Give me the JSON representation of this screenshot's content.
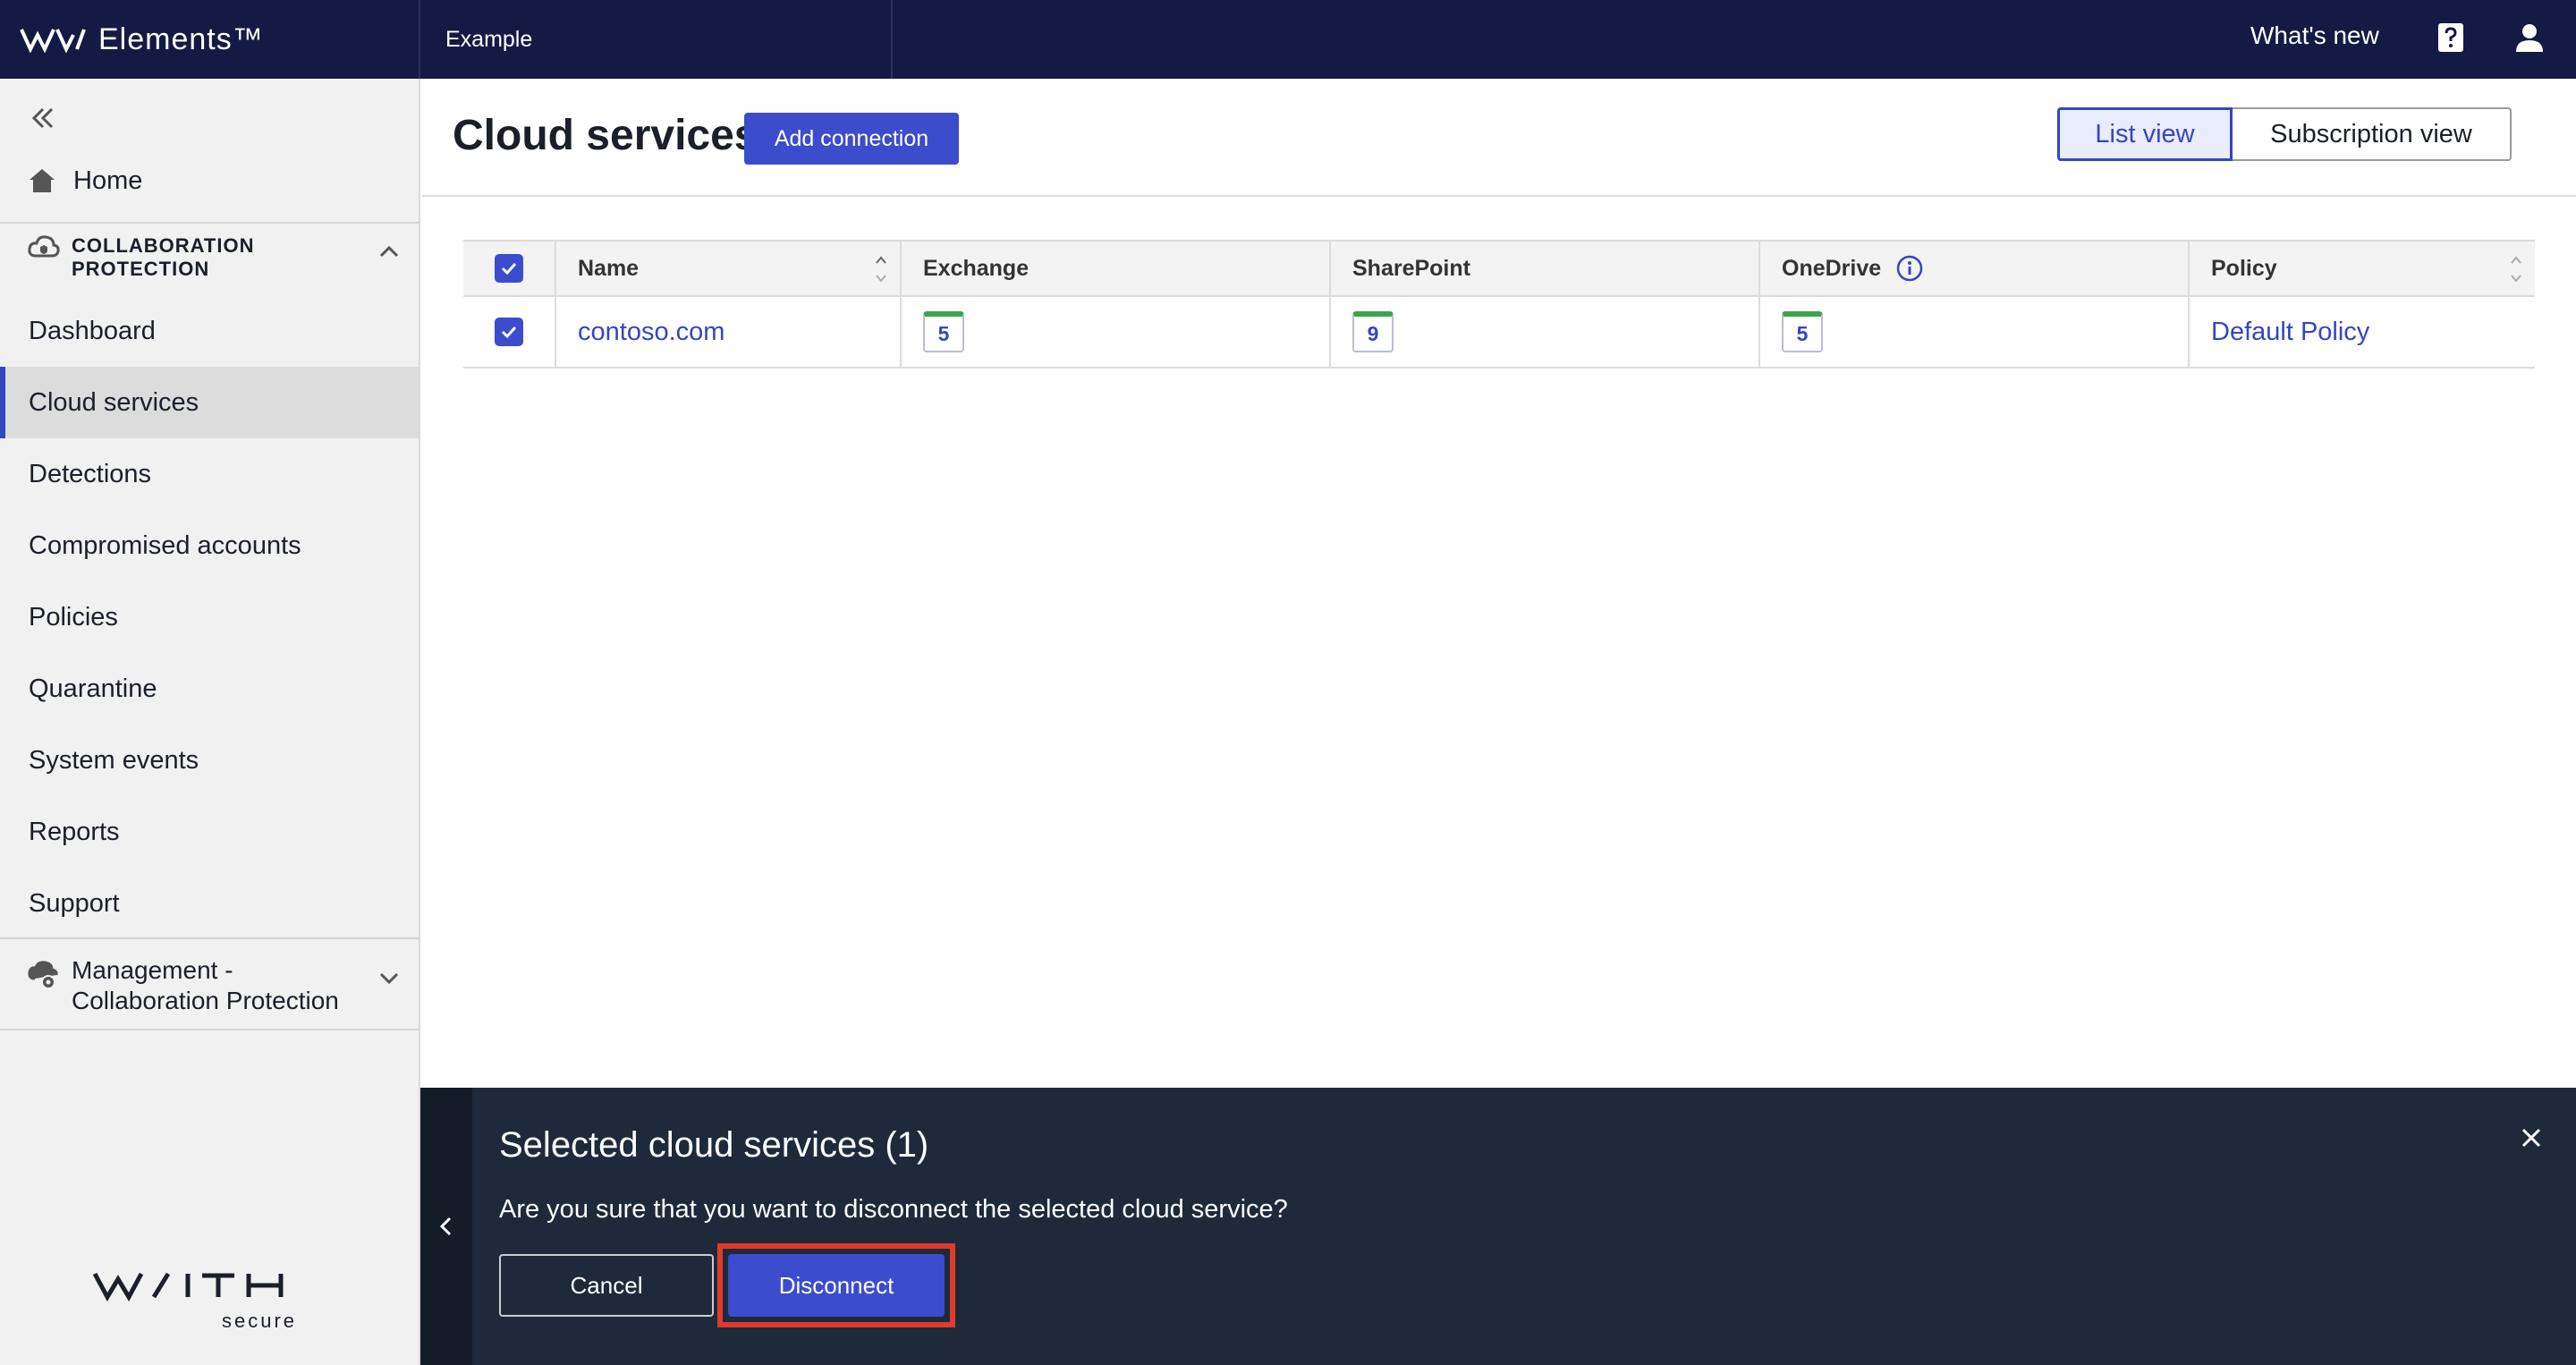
{
  "topbar": {
    "brand": "Elements™",
    "org": "Example",
    "whats_new": "What's new"
  },
  "sidebar": {
    "home": "Home",
    "section_title": "COLLABORATION PROTECTION",
    "items": [
      {
        "label": "Dashboard"
      },
      {
        "label": "Cloud services",
        "active": true
      },
      {
        "label": "Detections"
      },
      {
        "label": "Compromised accounts"
      },
      {
        "label": "Policies"
      },
      {
        "label": "Quarantine"
      },
      {
        "label": "System events"
      },
      {
        "label": "Reports"
      },
      {
        "label": "Support"
      }
    ],
    "management_title": "Management - Collaboration Protection",
    "footer_logo_word": "WITH",
    "footer_logo_sub": "secure"
  },
  "main": {
    "title": "Cloud services",
    "add_connection": "Add connection",
    "views": {
      "list": "List view",
      "subscription": "Subscription view",
      "selected": "list"
    },
    "table": {
      "columns": [
        "Name",
        "Exchange",
        "SharePoint",
        "OneDrive",
        "Policy"
      ],
      "rows": [
        {
          "checked": true,
          "name": "contoso.com",
          "exchange": "5",
          "sharepoint": "9",
          "onedrive": "5",
          "policy": "Default Policy"
        }
      ]
    }
  },
  "panel": {
    "title": "Selected cloud services (1)",
    "message": "Are you sure that you want to disconnect the selected cloud service?",
    "cancel": "Cancel",
    "disconnect": "Disconnect"
  },
  "colors": {
    "topbar": "#141a43",
    "accent": "#3b4ccc",
    "panel": "#1e2a3a",
    "highlight": "#e23a2b",
    "badge_top": "#3aa64a"
  }
}
